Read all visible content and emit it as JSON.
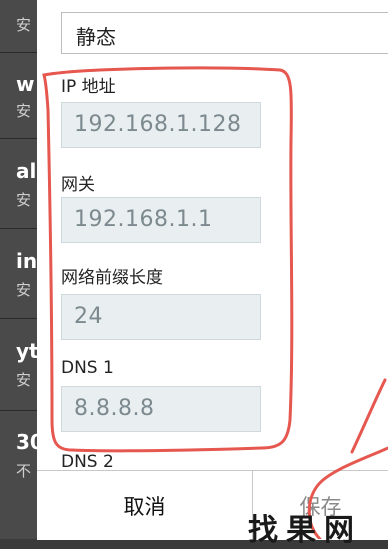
{
  "background_list": {
    "items": [
      {
        "title": "w",
        "subtitle": "安"
      },
      {
        "title": "al",
        "subtitle": "安"
      },
      {
        "title": "in",
        "subtitle": "安"
      },
      {
        "title": "yt",
        "subtitle": "安"
      },
      {
        "title": "30",
        "subtitle": "不"
      }
    ],
    "top_subtitle": "安"
  },
  "dialog": {
    "ip_settings_value": "静态",
    "fields": [
      {
        "label": "IP 地址",
        "value": "192.168.1.128"
      },
      {
        "label": "网关",
        "value": "192.168.1.1"
      },
      {
        "label": "网络前缀长度",
        "value": "24"
      },
      {
        "label": "DNS 1",
        "value": "8.8.8.8"
      }
    ],
    "dns2_label": "DNS 2",
    "cancel_label": "取消",
    "save_label": "保存"
  },
  "watermark": "找果网",
  "colors": {
    "annotation": "#e5574f",
    "input_bg": "#e9eef0"
  }
}
